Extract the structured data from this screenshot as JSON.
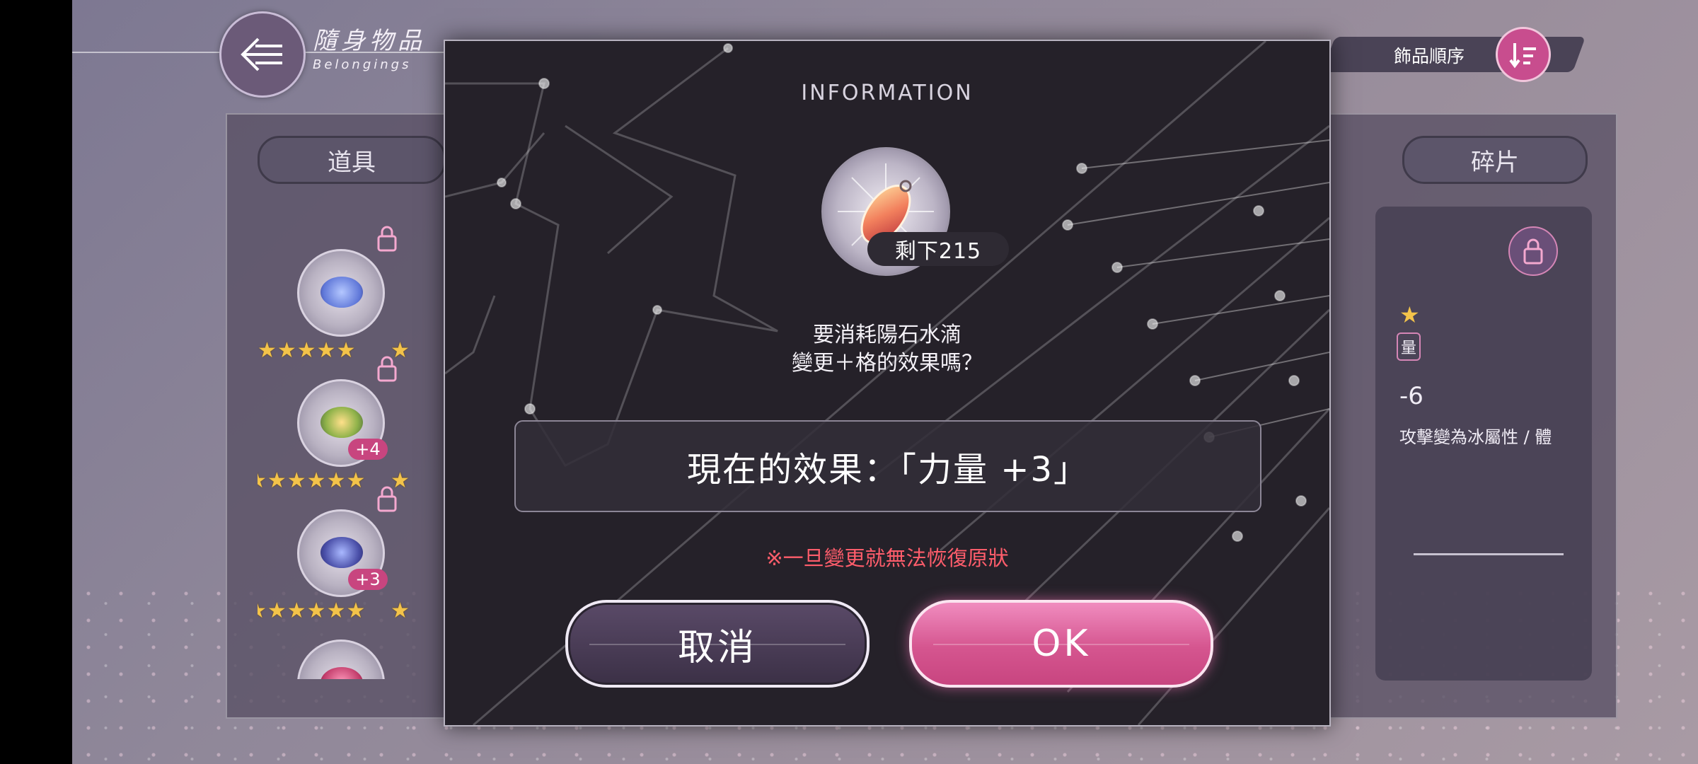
{
  "header": {
    "title": "隨身物品",
    "subtitle": "Belongings",
    "sort_label": "飾品順序"
  },
  "tabs": {
    "left": "道具",
    "right": "碎片"
  },
  "items": [
    {
      "stars": "★★★★★",
      "extra_star": "★",
      "plus": ""
    },
    {
      "stars": "★★★★★★",
      "extra_star": "★",
      "plus": "+4"
    },
    {
      "stars": "★★★★★★",
      "extra_star": "★",
      "plus": "+3"
    }
  ],
  "detail": {
    "star": "★",
    "badge_fragment": "量",
    "value_fragment": "-6",
    "desc_fragment": "攻擊變為冰屬性 / 體"
  },
  "dialog": {
    "title": "INFORMATION",
    "remaining": "剩下215",
    "question_line1": "要消耗陽石水滴",
    "question_line2": "變更＋格的效果嗎？",
    "current_effect": "現在的效果：「力量 +3」",
    "warning": "※一旦變更就無法恢復原狀",
    "cancel_label": "取消",
    "ok_label": "OK"
  },
  "colors": {
    "accent_pink": "#d5558f",
    "warning_red": "#ff5d6b",
    "star_gold": "#f3c34a"
  }
}
